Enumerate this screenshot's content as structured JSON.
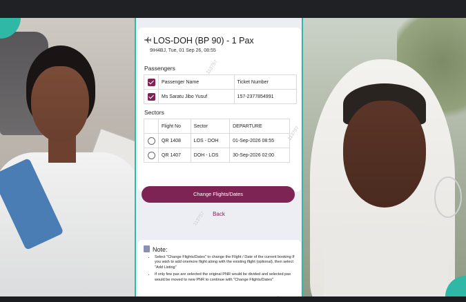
{
  "flight": {
    "title": "LOS-DOH (BP 90) - 1 Pax",
    "subtitle": "9IH4BJ, Tue, 01 Sep 26, 08:55"
  },
  "passengers": {
    "label": "Passengers",
    "headers": [
      "Passenger Name",
      "Ticket Number"
    ],
    "rows": [
      {
        "name": "Ms Saratu Jibo Yusuf",
        "ticket": "157-2377854991",
        "checked": true
      }
    ]
  },
  "sectors": {
    "label": "Sectors",
    "headers": [
      "Flight No",
      "Sector",
      "DEPARTURE"
    ],
    "rows": [
      {
        "flight": "QR 1408",
        "sector": "LOS - DOH",
        "departure": "01-Sep-2026 08:55"
      },
      {
        "flight": "QR 1407",
        "sector": "DOH - LOS",
        "departure": "30-Sep-2026 02:00"
      }
    ]
  },
  "actions": {
    "change_label": "Change Flights/Dates",
    "back_label": "Back"
  },
  "note": {
    "title": "Note:",
    "items": [
      "Select \"Change Flights/Dates\" to change the Flight / Date of the current booking If you wish to add onemore flight along with the existing flight (optional), then select \"Add Listing\"",
      "If only few pax are selected the original PNR would be divided and selected pax would be moved to new PNR to continue with \"Change Flights/Dates\""
    ]
  },
  "watermark": "113757",
  "colors": {
    "accent": "#7d2454",
    "frame_border": "#2fb8a6"
  }
}
